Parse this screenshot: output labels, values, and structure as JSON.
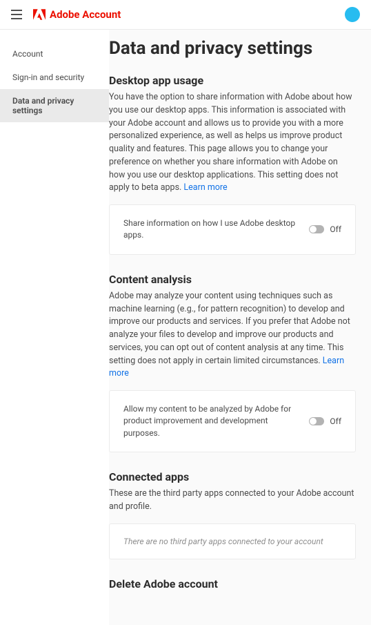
{
  "header": {
    "brand": "Adobe Account"
  },
  "sidebar": {
    "items": [
      {
        "label": "Account"
      },
      {
        "label": "Sign-in and security"
      },
      {
        "label": "Data and privacy settings"
      }
    ]
  },
  "page": {
    "title": "Data and privacy settings"
  },
  "desktop": {
    "title": "Desktop app usage",
    "desc": "You have the option to share information with Adobe about how you use our desktop apps. This information is associated with your Adobe account and allows us to provide you with a more personalized experience, as well as helps us improve product quality and features. This page allows you to change your preference on whether you share information with Adobe on how you use our desktop applications. This setting does not apply to beta apps. ",
    "learn": "Learn more",
    "toggle_label": "Share information on how I use Adobe desktop apps.",
    "toggle_state": "Off"
  },
  "content_analysis": {
    "title": "Content analysis",
    "desc": "Adobe may analyze your content using techniques such as machine learning (e.g., for pattern recognition) to develop and improve our products and services. If you prefer that Adobe not analyze your files to develop and improve our products and services, you can opt out of content analysis at any time. This setting does not apply in certain limited circumstances. ",
    "learn": "Learn more",
    "toggle_label": "Allow my content to be analyzed by Adobe for product improvement and development purposes.",
    "toggle_state": "Off"
  },
  "connected": {
    "title": "Connected apps",
    "desc": "These are the third party apps connected to your Adobe account and profile.",
    "empty": "There are no third party apps connected to your account"
  },
  "delete": {
    "title": "Delete Adobe account"
  }
}
